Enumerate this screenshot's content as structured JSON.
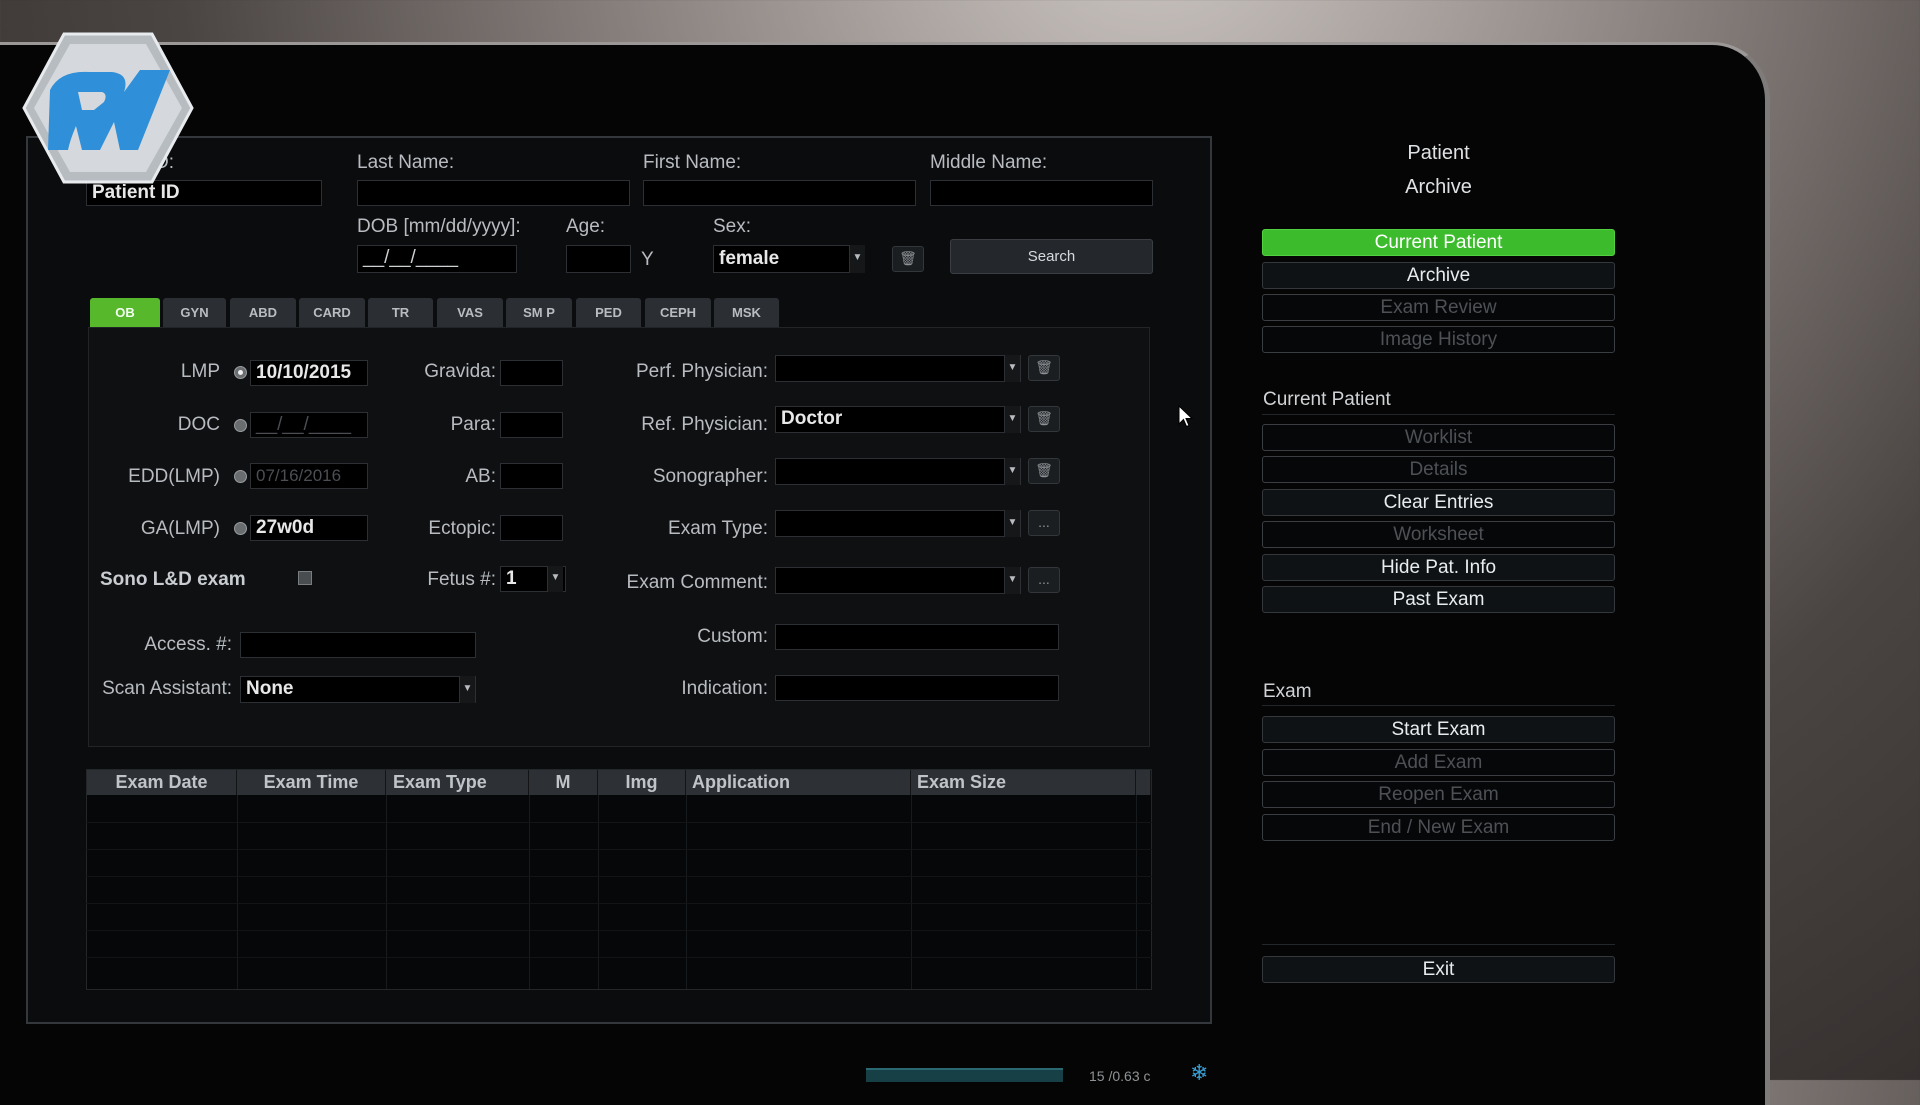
{
  "patient_header": {
    "patient_id_label": "D:",
    "patient_id_value": "Patient ID",
    "last_name_label": "Last Name:",
    "first_name_label": "First Name:",
    "middle_name_label": "Middle Name:",
    "dob_label": "DOB [mm/dd/yyyy]:",
    "dob_placeholder": "__/__/____",
    "age_label": "Age:",
    "age_unit": "Y",
    "sex_label": "Sex:",
    "sex_value": "female",
    "search_label": "Search"
  },
  "tabs": [
    {
      "label": "OB",
      "active": true
    },
    {
      "label": "GYN"
    },
    {
      "label": "ABD"
    },
    {
      "label": "CARD"
    },
    {
      "label": "TR"
    },
    {
      "label": "VAS"
    },
    {
      "label": "SM P"
    },
    {
      "label": "PED"
    },
    {
      "label": "CEPH"
    },
    {
      "label": "MSK"
    }
  ],
  "ob_form": {
    "lmp_label": "LMP",
    "lmp_value": "10/10/2015",
    "doc_label": "DOC",
    "doc_value": "__/__/____",
    "edd_label": "EDD(LMP)",
    "edd_value": "07/16/2016",
    "ga_label": "GA(LMP)",
    "ga_value": "27w0d",
    "sono_ld_label": "Sono L&D exam",
    "gravida_label": "Gravida:",
    "para_label": "Para:",
    "ab_label": "AB:",
    "ectopic_label": "Ectopic:",
    "fetus_label": "Fetus #:",
    "fetus_value": "1",
    "perf_physician_label": "Perf. Physician:",
    "ref_physician_label": "Ref. Physician:",
    "ref_physician_value": "Doctor",
    "sonographer_label": "Sonographer:",
    "exam_type_label": "Exam Type:",
    "exam_comment_label": "Exam Comment:",
    "custom_label": "Custom:",
    "indication_label": "Indication:",
    "access_label": "Access. #:",
    "scan_assistant_label": "Scan Assistant:",
    "scan_assistant_value": "None",
    "more_label": "..."
  },
  "exam_table": {
    "columns": [
      "Exam Date",
      "Exam Time",
      "Exam Type",
      "M",
      "Img",
      "Application",
      "Exam Size"
    ]
  },
  "right_panel": {
    "title_line1": "Patient",
    "title_line2": "Archive",
    "nav_buttons": [
      {
        "label": "Current Patient",
        "state": "active"
      },
      {
        "label": "Archive",
        "state": "enabled"
      },
      {
        "label": "Exam Review",
        "state": "disabled"
      },
      {
        "label": "Image History",
        "state": "disabled"
      }
    ],
    "current_patient_heading": "Current Patient",
    "current_patient_buttons": [
      {
        "label": "Worklist",
        "state": "disabled"
      },
      {
        "label": "Details",
        "state": "disabled"
      },
      {
        "label": "Clear Entries",
        "state": "enabled"
      },
      {
        "label": "Worksheet",
        "state": "disabled"
      },
      {
        "label": "Hide Pat. Info",
        "state": "enabled"
      },
      {
        "label": "Past Exam",
        "state": "enabled"
      }
    ],
    "exam_heading": "Exam",
    "exam_buttons": [
      {
        "label": "Start Exam",
        "state": "enabled"
      },
      {
        "label": "Add Exam",
        "state": "disabled"
      },
      {
        "label": "Reopen Exam",
        "state": "disabled"
      },
      {
        "label": "End / New Exam",
        "state": "disabled"
      }
    ],
    "exit_label": "Exit"
  },
  "status_bar": {
    "text": "15 /0.63 c"
  },
  "colors": {
    "active_green": "#3cbc2c",
    "tab_green": "#57b82c",
    "logo_blue": "#2f8fd8"
  }
}
